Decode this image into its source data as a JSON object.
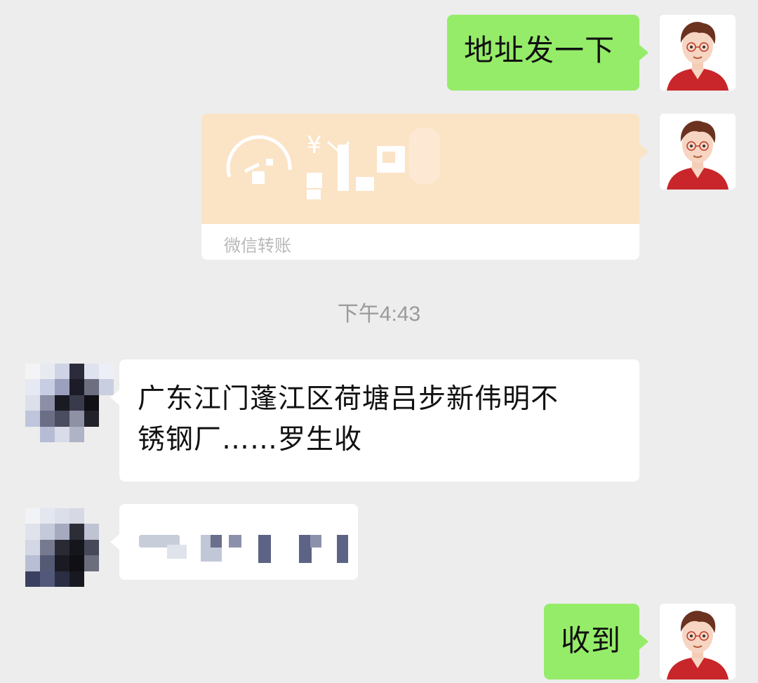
{
  "messages": {
    "m1": {
      "sender": "me",
      "text": "地址发一下"
    },
    "m2": {
      "sender": "me",
      "type": "transfer",
      "label": "微信转账",
      "amount_prefix": "¥"
    },
    "time": "下午4:43",
    "m3": {
      "sender": "them",
      "line1": "广东江门蓬江区荷塘吕步新伟明不",
      "line2": "锈钢厂……罗生收"
    },
    "m4": {
      "sender": "them",
      "note": "redacted phone number"
    },
    "m5": {
      "sender": "me",
      "text": "收到"
    }
  },
  "colors": {
    "background": "#ededed",
    "my_bubble": "#95ec69",
    "their_bubble": "#ffffff",
    "transfer_card": "#fbe3c5",
    "avatar_shirt": "#c8262a"
  }
}
